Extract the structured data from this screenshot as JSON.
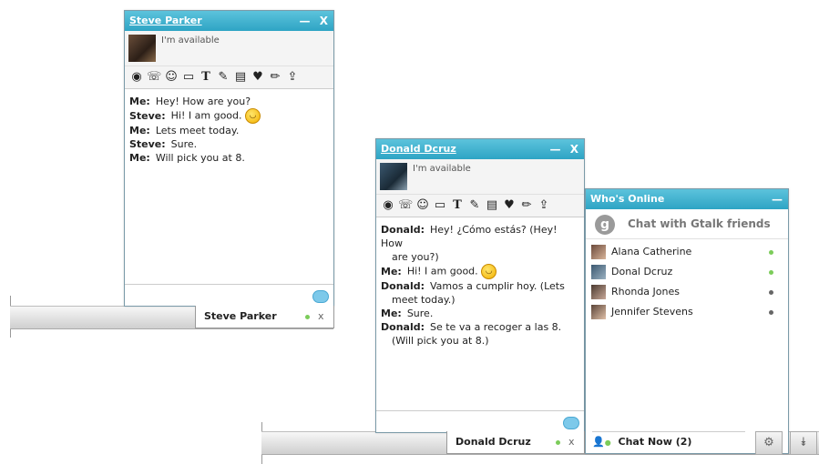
{
  "steve_window": {
    "title": "Steve Parker",
    "status": "I'm available",
    "messages": [
      {
        "who": "Me:",
        "text": "Hey! How are you?"
      },
      {
        "who": "Steve:",
        "text": "Hi! I am good.",
        "emoji": true
      },
      {
        "who": "Me:",
        "text": "Lets meet today."
      },
      {
        "who": "Steve:",
        "text": "Sure."
      },
      {
        "who": "Me:",
        "text": "Will pick you at 8."
      }
    ],
    "tab_label": "Steve Parker"
  },
  "donal_window": {
    "title": "Donald Dcruz",
    "status": "I'm available",
    "messages": [
      {
        "who": "Donald:",
        "text": "Hey! ¿Cómo estás? (Hey! How",
        "cont": "are you?)"
      },
      {
        "who": "Me:",
        "text": "Hi! I am good.",
        "emoji": true
      },
      {
        "who": "Donald:",
        "text": "Vamos a cumplir hoy. (Lets",
        "cont": "meet today.)"
      },
      {
        "who": "Me:",
        "text": "Sure."
      },
      {
        "who": "Donald:",
        "text": "Se te va a recoger a las 8.",
        "cont": "(Will pick you at 8.)"
      }
    ],
    "tab_label": "Donald Dcruz"
  },
  "whos_online": {
    "title": "Who's Online",
    "gtalk_label": "Chat with Gtalk friends",
    "friends": [
      {
        "name": "Alana Catherine",
        "status_color": "#7ccc5a"
      },
      {
        "name": "Donal Dcruz",
        "status_color": "#7ccc5a"
      },
      {
        "name": "Rhonda Jones",
        "status_color": "#666666"
      },
      {
        "name": "Jennifer Stevens",
        "status_color": "#666666"
      }
    ],
    "chat_now_label": "Chat Now (2)"
  },
  "icons": {
    "minimize": "—",
    "close": "X",
    "tab_close": "x",
    "settings": "⚙",
    "collapse": "⯯"
  }
}
